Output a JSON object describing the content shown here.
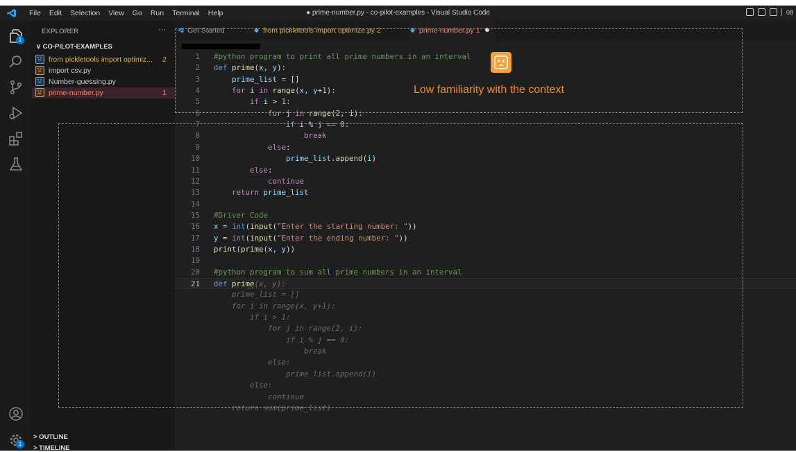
{
  "titlebar": {
    "menu": [
      "File",
      "Edit",
      "Selection",
      "View",
      "Go",
      "Run",
      "Terminal",
      "Help"
    ],
    "window_title": "● prime-number.py - co-pilot-examples - Visual Studio Code",
    "right_text": "08"
  },
  "activity": {
    "explorer_badge": "1",
    "accounts_badge": "1"
  },
  "sidebar": {
    "header": "EXPLORER",
    "more": "···",
    "folder": "∨ CO-PILOT-EXAMPLES",
    "files": [
      {
        "name": "from pickletools import optimiz...",
        "count": "2",
        "icon_color": "#6aa8e0",
        "text_color": "#e0b050"
      },
      {
        "name": "import csv.py",
        "count": "",
        "icon_color": "#e8a044",
        "text_color": "#cccccc"
      },
      {
        "name": "Number-guessing.py",
        "count": "",
        "icon_color": "#6aa8e0",
        "text_color": "#cccccc"
      },
      {
        "name": "prime-number.py",
        "count": "1",
        "icon_color": "#e8a044",
        "text_color": "#f48771"
      }
    ],
    "outline": "> OUTLINE",
    "timeline": "> TIMELINE"
  },
  "tabs": [
    {
      "label": "Get Started",
      "suffix": ""
    },
    {
      "label": "from pickletools import optimize.py",
      "suffix": "2"
    },
    {
      "label": "prime-number.py",
      "suffix": "1"
    }
  ],
  "code_lines": [
    {
      "n": "1",
      "html": "<span class='c'>#python program to print all prime numbers in an interval</span>"
    },
    {
      "n": "2",
      "html": "<span class='kb'>def</span> <span class='f'>prime</span><span class='p'>(</span><span class='v'>x</span><span class='p'>, </span><span class='v'>y</span><span class='p'>):</span>"
    },
    {
      "n": "3",
      "html": "    <span class='v'>prime_list</span> <span class='p'>= []</span>"
    },
    {
      "n": "4",
      "html": "    <span class='k'>for</span> <span class='v'>i</span> <span class='k'>in</span> <span class='f'>range</span><span class='p'>(</span><span class='v'>x</span><span class='p'>, </span><span class='v'>y</span><span class='p'>+</span><span class='n'>1</span><span class='p'>):</span>"
    },
    {
      "n": "5",
      "html": "        <span class='k'>if</span> <span class='v'>i</span> <span class='p'>&gt;</span> <span class='n'>1</span><span class='p'>:</span>"
    },
    {
      "n": "6",
      "html": "            <span class='k'>for</span> <span class='v'>j</span> <span class='k'>in</span> <span class='f'>range</span><span class='p'>(</span><span class='n'>2</span><span class='p'>, </span><span class='v'>i</span><span class='p'>):</span>"
    },
    {
      "n": "7",
      "html": "                <span class='k'>if</span> <span class='v'>i</span> <span class='p'>%</span> <span class='v'>j</span> <span class='p'>==</span> <span class='n'>0</span><span class='p'>:</span>"
    },
    {
      "n": "8",
      "html": "                    <span class='k'>break</span>"
    },
    {
      "n": "9",
      "html": "            <span class='k'>else</span><span class='p'>:</span>"
    },
    {
      "n": "10",
      "html": "                <span class='v'>prime_list</span><span class='p'>.</span><span class='f'>append</span><span class='p'>(</span><span class='v'>i</span><span class='p'>)</span>"
    },
    {
      "n": "11",
      "html": "        <span class='k'>else</span><span class='p'>:</span>"
    },
    {
      "n": "12",
      "html": "            <span class='k'>continue</span>"
    },
    {
      "n": "13",
      "html": "    <span class='k'>return</span> <span class='v'>prime_list</span>"
    },
    {
      "n": "14",
      "html": ""
    },
    {
      "n": "15",
      "html": "<span class='c'>#Driver Code</span>"
    },
    {
      "n": "16",
      "html": "<span class='v'>x</span> <span class='p'>=</span> <span class='kb'>int</span><span class='p'>(</span><span class='f'>input</span><span class='p'>(</span><span class='s'>\"Enter the starting number: \"</span><span class='p'>))</span>"
    },
    {
      "n": "17",
      "html": "<span class='v'>y</span> <span class='p'>=</span> <span class='kb'>int</span><span class='p'>(</span><span class='f'>input</span><span class='p'>(</span><span class='s'>\"Enter the ending number: \"</span><span class='p'>))</span>"
    },
    {
      "n": "18",
      "html": "<span class='f'>print</span><span class='p'>(</span><span class='f'>prime</span><span class='p'>(</span><span class='v'>x</span><span class='p'>, </span><span class='v'>y</span><span class='p'>))</span>"
    },
    {
      "n": "19",
      "html": ""
    },
    {
      "n": "20",
      "html": "<span class='c'>#python program to sum all prime numbers in an interval</span>"
    },
    {
      "n": "21",
      "html": "<span class='kb'>def</span> <span class='f'>prime</span><span class='gh'>(x, y):</span>"
    },
    {
      "n": "",
      "html": "    <span class='gh'>prime_list = []</span>"
    },
    {
      "n": "",
      "html": "    <span class='gh'>for i in range(x, y+1):</span>"
    },
    {
      "n": "",
      "html": "        <span class='gh'>if i &gt; 1:</span>"
    },
    {
      "n": "",
      "html": "            <span class='gh'>for j in range(2, i):</span>"
    },
    {
      "n": "",
      "html": "                <span class='gh'>if i % j == 0:</span>"
    },
    {
      "n": "",
      "html": "                    <span class='gh'>break</span>"
    },
    {
      "n": "",
      "html": "            <span class='gh'>else:</span>"
    },
    {
      "n": "",
      "html": "                <span class='gh'>prime_list.append(i)</span>"
    },
    {
      "n": "",
      "html": "        <span class='gh'>else:</span>"
    },
    {
      "n": "",
      "html": "            <span class='gh'>continue</span>"
    },
    {
      "n": "",
      "html": "    <span class='gh'>return sum(prime_list)</span>"
    }
  ],
  "current_line": "21",
  "annotation": {
    "text": "Low familiarity with the context",
    "color": "#f28b2a",
    "icon": "sad-face-icon"
  }
}
